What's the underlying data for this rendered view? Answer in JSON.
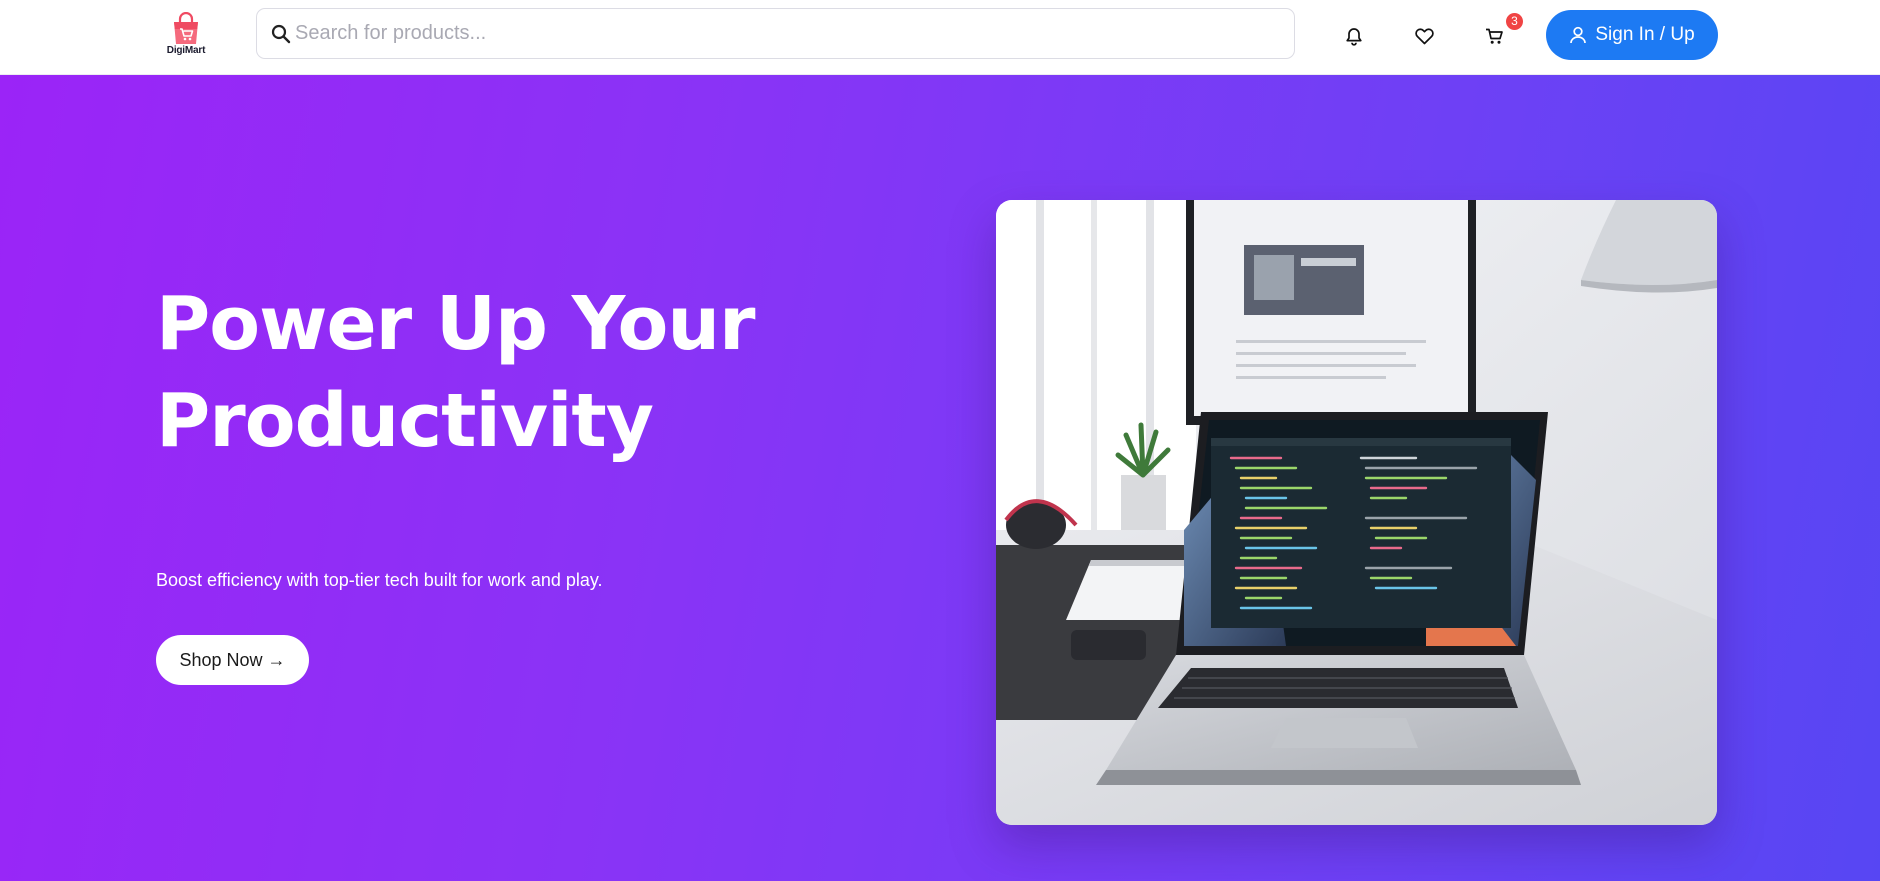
{
  "header": {
    "logo_text": "DigiMart",
    "search_placeholder": "Search for products...",
    "cart_count": "3",
    "signin_label": "Sign In / Up"
  },
  "hero": {
    "title_line1": "Power Up Your",
    "title_line2": "Productivity",
    "subtitle": "Boost efficiency with top-tier tech built for work and play.",
    "cta_label": "Shop Now →"
  },
  "colors": {
    "brand_accent": "#1d7af3",
    "logo_bag": "#f04a62",
    "badge": "#f04444",
    "hero_gradient_start": "#9b24f7",
    "hero_gradient_end": "#5746f3"
  },
  "icons": {
    "logo": "shopping-bag-icon",
    "search": "search-icon",
    "notifications": "bell-icon",
    "wishlist": "heart-icon",
    "cart": "cart-icon",
    "account": "user-icon"
  }
}
